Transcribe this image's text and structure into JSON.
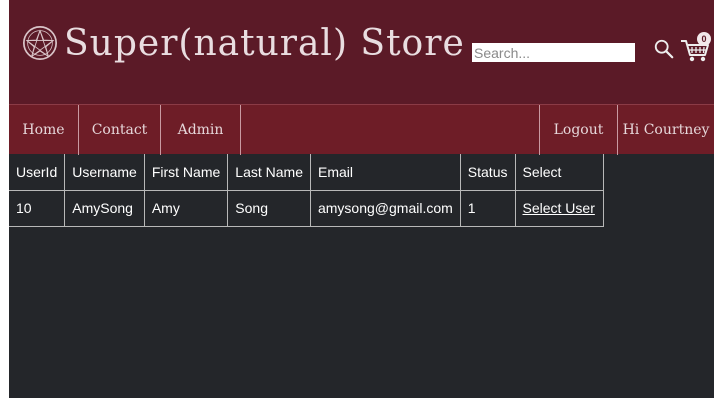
{
  "header": {
    "store_title": "Super(natural) Store",
    "logo_icon": "pentacle-icon",
    "search": {
      "placeholder": "Search...",
      "value": ""
    },
    "search_icon": "search-icon",
    "cart_icon": "cart-icon",
    "cart_count": "0"
  },
  "nav": {
    "items": [
      {
        "label": "Home"
      },
      {
        "label": "Contact"
      },
      {
        "label": "Admin"
      },
      {
        "label": "Logout"
      },
      {
        "label": "Hi Courtney"
      }
    ]
  },
  "table": {
    "columns": [
      "UserId",
      "Username",
      "First Name",
      "Last Name",
      "Email",
      "Status",
      "Select"
    ],
    "rows": [
      {
        "user_id": "10",
        "username": "AmySong",
        "first_name": "Amy",
        "last_name": "Song",
        "email": "amysong@gmail.com",
        "status": "1",
        "select_label": "Select User"
      }
    ]
  },
  "colors": {
    "header_bg": "#5b1a27",
    "nav_bg": "#6e1d27",
    "body_bg": "#24262a"
  }
}
